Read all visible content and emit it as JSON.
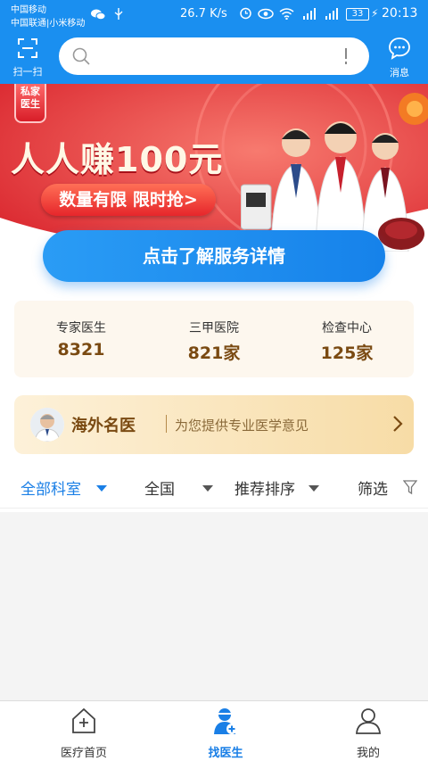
{
  "status_bar": {
    "carrier_1": "中国移动",
    "carrier_2": "中国联通|小米移动",
    "speed": "26.7 K/s",
    "battery": "33",
    "time": "20:13"
  },
  "header": {
    "scan_label": "扫一扫",
    "search_placeholder": "",
    "message_label": "消息"
  },
  "banner": {
    "badge": "私家医生",
    "title": "人人赚100元",
    "button": "数量有限 限时抢>"
  },
  "cta": {
    "label": "点击了解服务详情"
  },
  "stats": [
    {
      "label": "专家医生",
      "value": "8321"
    },
    {
      "label": "三甲医院",
      "value": "821家"
    },
    {
      "label": "检查中心",
      "value": "125家"
    }
  ],
  "overseas": {
    "title": "海外名医",
    "subtitle": "为您提供专业医学意见"
  },
  "filters": [
    {
      "label": "全部科室",
      "active": true
    },
    {
      "label": "全国"
    },
    {
      "label": "推荐排序"
    },
    {
      "label": "筛选"
    }
  ],
  "tabs": [
    {
      "label": "医疗首页",
      "icon": "medical-home-icon"
    },
    {
      "label": "找医生",
      "icon": "find-doctor-icon",
      "active": true
    },
    {
      "label": "我的",
      "icon": "profile-icon"
    }
  ],
  "colors": {
    "primary": "#1a8ff0",
    "banner_red": "#e63a3a",
    "gold_text": "#7a4a12",
    "active_blue": "#1a7fe6"
  }
}
